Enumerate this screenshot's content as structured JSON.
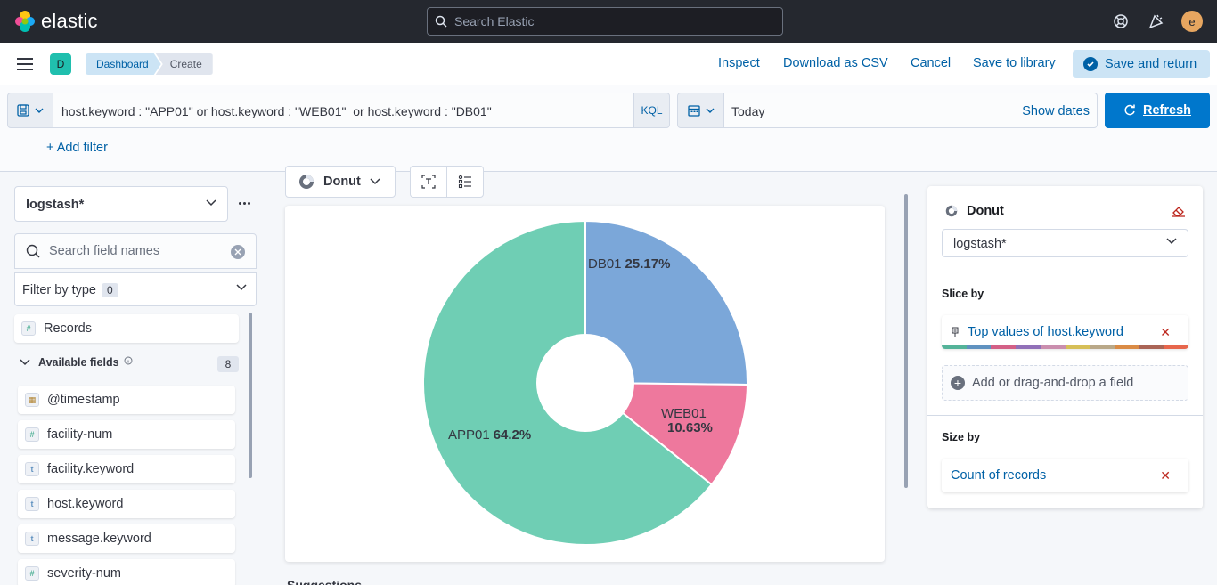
{
  "header": {
    "brand": "elastic",
    "search_placeholder": "Search Elastic",
    "avatar_initial": "e",
    "icons": [
      "help-icon",
      "newsfeed-icon"
    ]
  },
  "subheader": {
    "space_initial": "D",
    "breadcrumbs": [
      "Dashboard",
      "Create"
    ],
    "actions": {
      "inspect": "Inspect",
      "download": "Download as CSV",
      "cancel": "Cancel",
      "save_library": "Save to library",
      "save_return": "Save and return"
    }
  },
  "querybar": {
    "query": "host.keyword : \"APP01\" or host.keyword : \"WEB01\"  or host.keyword : \"DB01\"",
    "language": "KQL",
    "date_value": "Today",
    "show_dates": "Show dates",
    "refresh": "Refresh",
    "add_filter": "+ Add filter"
  },
  "datapanel": {
    "index": "logstash*",
    "search_placeholder": "Search field names",
    "filter_type_label": "Filter by type",
    "filter_type_count": "0",
    "records": "Records",
    "available_label": "Available fields",
    "available_count": "8",
    "fields": [
      {
        "name": "@timestamp",
        "type": "date"
      },
      {
        "name": "facility-num",
        "type": "number"
      },
      {
        "name": "facility.keyword",
        "type": "string"
      },
      {
        "name": "host.keyword",
        "type": "string"
      },
      {
        "name": "message.keyword",
        "type": "string"
      },
      {
        "name": "severity-num",
        "type": "number"
      }
    ]
  },
  "workspace": {
    "chart_type_label": "Donut",
    "suggestions": "Suggestions"
  },
  "config": {
    "title": "Donut",
    "index": "logstash*",
    "slice_by_label": "Slice by",
    "slice_by_value": "Top values of host.keyword",
    "add_field": "Add or drag-and-drop a field",
    "size_by_label": "Size by",
    "size_by_value": "Count of records",
    "palette": [
      "#54b399",
      "#6092c0",
      "#d36086",
      "#9170b8",
      "#ca8eae",
      "#d6bf57",
      "#b9a888",
      "#da8b45",
      "#aa6556",
      "#e7664c"
    ]
  },
  "chart_data": {
    "type": "pie",
    "donut": true,
    "slices": [
      {
        "label": "DB01",
        "pct_label": "25.17%",
        "value": 25.17,
        "color": "#7ba7d9"
      },
      {
        "label": "WEB01",
        "pct_label": "10.63%",
        "value": 10.63,
        "color": "#ee789d"
      },
      {
        "label": "APP01",
        "pct_label": "64.2%",
        "value": 64.2,
        "color": "#6fceb4"
      }
    ]
  }
}
